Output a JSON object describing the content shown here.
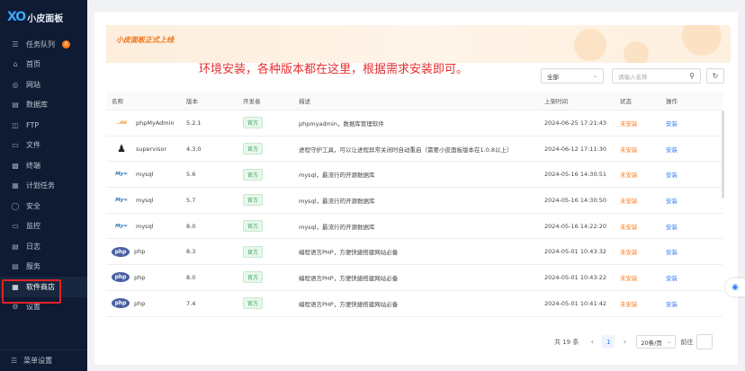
{
  "app": {
    "logo_mark": "XO",
    "logo_text": "小皮面板"
  },
  "sidebar": {
    "items": [
      {
        "label": "任务队列",
        "icon": "list-icon",
        "badge": "0"
      },
      {
        "label": "首页",
        "icon": "home-icon"
      },
      {
        "label": "网站",
        "icon": "globe-icon"
      },
      {
        "label": "数据库",
        "icon": "database-icon"
      },
      {
        "label": "FTP",
        "icon": "ftp-icon"
      },
      {
        "label": "文件",
        "icon": "folder-icon"
      },
      {
        "label": "终端",
        "icon": "terminal-icon"
      },
      {
        "label": "计划任务",
        "icon": "calendar-icon"
      },
      {
        "label": "安全",
        "icon": "shield-icon"
      },
      {
        "label": "监控",
        "icon": "monitor-icon"
      },
      {
        "label": "日志",
        "icon": "log-icon"
      },
      {
        "label": "服务",
        "icon": "service-icon"
      },
      {
        "label": "软件商店",
        "icon": "store-icon",
        "active": true
      },
      {
        "label": "设置",
        "icon": "gear-icon"
      }
    ],
    "menu_setting": "菜单设置"
  },
  "banner": {
    "title": "小皮面板正式上线"
  },
  "headline": "环境安装，各种版本都在这里，根据需求安装即可。",
  "filter": {
    "selected": "全部",
    "search_placeholder": "请输入名称"
  },
  "table": {
    "headers": {
      "name": "名称",
      "version": "版本",
      "developer": "开发者",
      "description": "描述",
      "time": "上架时间",
      "status": "状态",
      "operation": "操作"
    },
    "rows": [
      {
        "logo": "phpMyAdmin",
        "name": "phpMyAdmin",
        "version": "5.2.1",
        "developer": "官方",
        "description": "phpmyadmin，数据库管理软件",
        "time": "2024-06-25 17:21:43",
        "status": "未安装",
        "operation": "安装"
      },
      {
        "logo": "supervisor",
        "name": "supervisor",
        "version": "4.3.0",
        "developer": "官方",
        "description": "进程守护工具，可以让进程异常关闭时自动重启（需要小皮面板版本在1.0.8以上）",
        "time": "2024-06-12 17:11:30",
        "status": "未安装",
        "operation": "安装"
      },
      {
        "logo": "mysql",
        "name": "mysql",
        "version": "5.6",
        "developer": "官方",
        "description": "mysql，最流行的开源数据库",
        "time": "2024-05-16 14:30:51",
        "status": "未安装",
        "operation": "安装"
      },
      {
        "logo": "mysql",
        "name": "mysql",
        "version": "5.7",
        "developer": "官方",
        "description": "mysql，最流行的开源数据库",
        "time": "2024-05-16 14:30:50",
        "status": "未安装",
        "operation": "安装"
      },
      {
        "logo": "mysql",
        "name": "mysql",
        "version": "8.0",
        "developer": "官方",
        "description": "mysql，最流行的开源数据库",
        "time": "2024-05-16 14:22:20",
        "status": "未安装",
        "operation": "安装"
      },
      {
        "logo": "php",
        "name": "php",
        "version": "8.3",
        "developer": "官方",
        "description": "编程语言PHP，方便快捷搭建网站必备",
        "time": "2024-05-01 10:43:32",
        "status": "未安装",
        "operation": "安装"
      },
      {
        "logo": "php",
        "name": "php",
        "version": "8.0",
        "developer": "官方",
        "description": "编程语言PHP，方便快捷搭建网站必备",
        "time": "2024-05-01 10:43:22",
        "status": "未安装",
        "operation": "安装"
      },
      {
        "logo": "php",
        "name": "php",
        "version": "7.4",
        "developer": "官方",
        "description": "编程语言PHP，方便快捷搭建网站必备",
        "time": "2024-05-01 10:41:42",
        "status": "未安装",
        "operation": "安装"
      }
    ]
  },
  "pagination": {
    "total": "共 19 条",
    "current_page": "1",
    "page_size": "20条/页",
    "goto_label": "前往"
  },
  "colors": {
    "sidebar_bg": "#0e1b33",
    "accent": "#2d7bf6",
    "warning": "#ff7a1a",
    "headline": "#e62d2d",
    "banner_title": "#f07316"
  }
}
